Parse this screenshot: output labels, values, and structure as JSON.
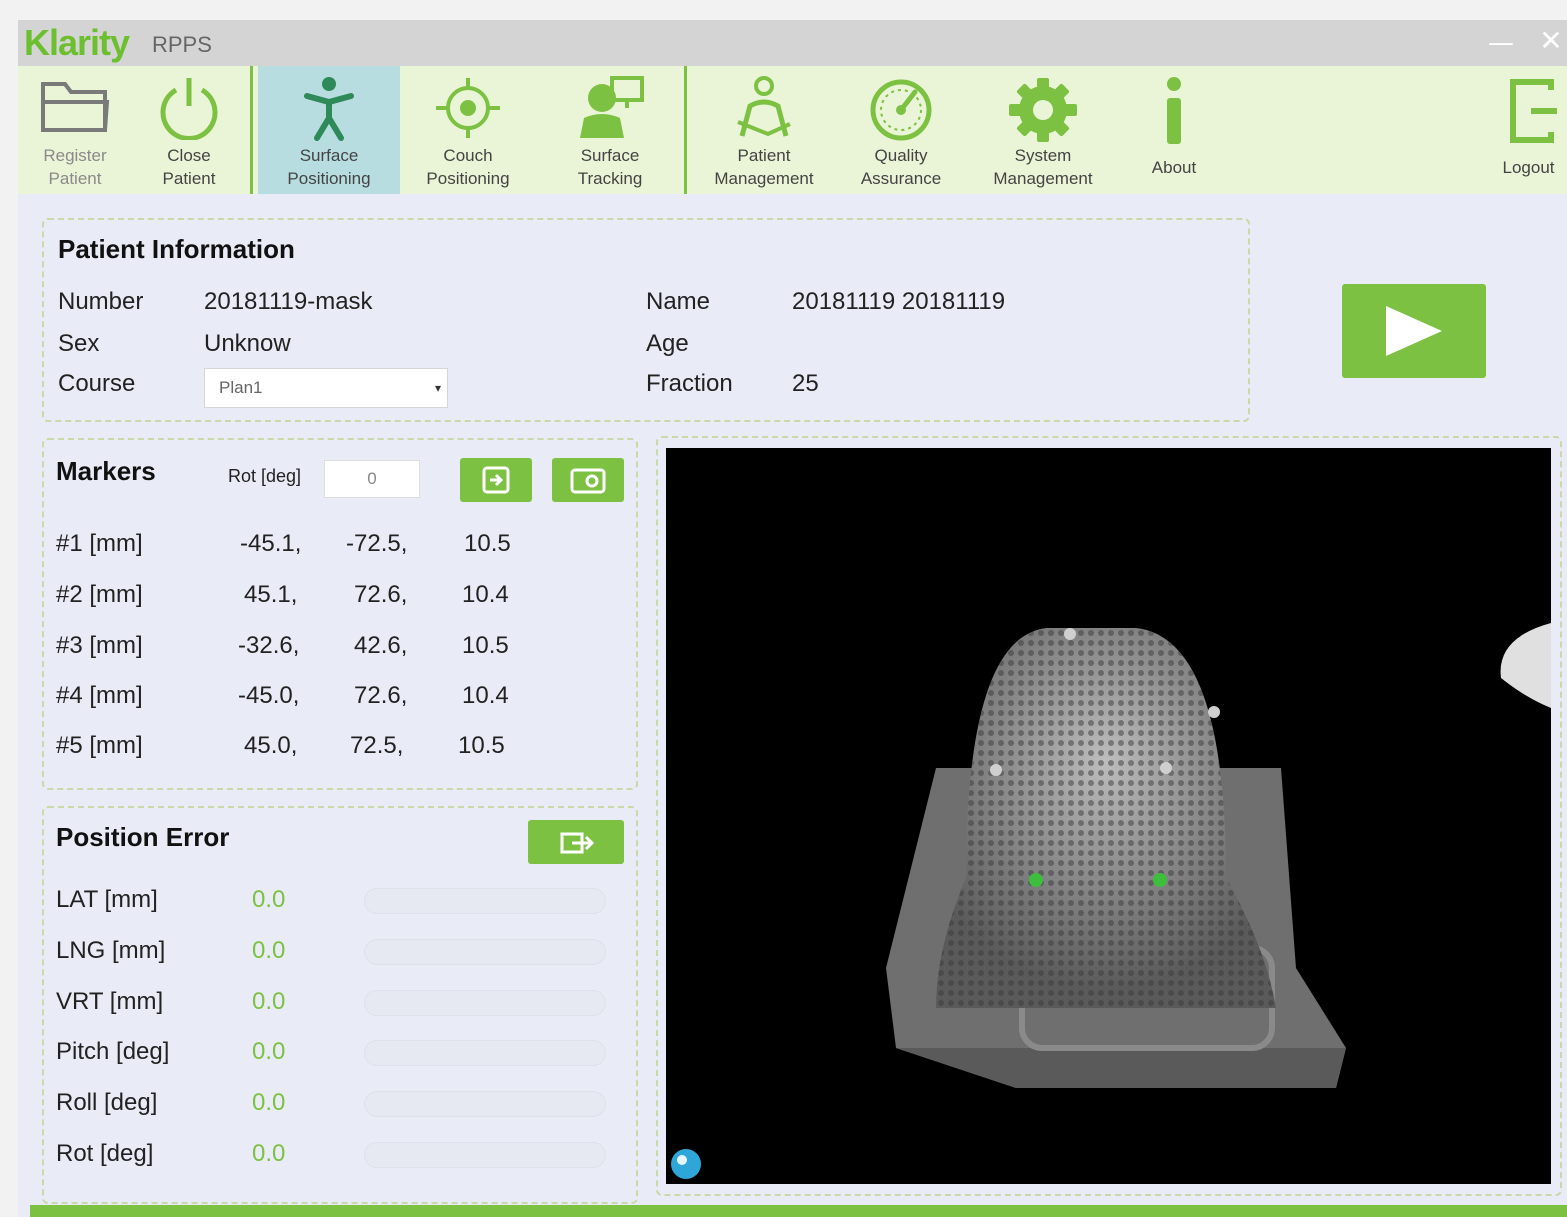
{
  "window": {
    "brand": "Klarity",
    "product": "RPPS",
    "minimize_glyph": "—",
    "close_glyph": "✕"
  },
  "toolbar": {
    "items": [
      {
        "line1": "Register",
        "line2": "Patient",
        "icon": "folder-icon",
        "state": "disabled"
      },
      {
        "line1": "Close",
        "line2": "Patient",
        "icon": "power-icon",
        "state": "normal"
      },
      {
        "line1": "Surface",
        "line2": "Positioning",
        "icon": "person-icon",
        "state": "active"
      },
      {
        "line1": "Couch",
        "line2": "Positioning",
        "icon": "crosshair-icon",
        "state": "normal"
      },
      {
        "line1": "Surface",
        "line2": "Tracking",
        "icon": "tracking-icon",
        "state": "normal"
      },
      {
        "line1": "Patient",
        "line2": "Management",
        "icon": "patient-management-icon",
        "state": "normal"
      },
      {
        "line1": "Quality",
        "line2": "Assurance",
        "icon": "gauge-icon",
        "state": "normal"
      },
      {
        "line1": "System",
        "line2": "Management",
        "icon": "gear-icon",
        "state": "normal"
      },
      {
        "line1": "About",
        "line2": "",
        "icon": "info-icon",
        "state": "normal"
      },
      {
        "line1": "Logout",
        "line2": "",
        "icon": "logout-icon",
        "state": "normal"
      }
    ]
  },
  "patient": {
    "title": "Patient Information",
    "number_label": "Number",
    "number_value": "20181119-mask",
    "sex_label": "Sex",
    "sex_value": "Unknow",
    "course_label": "Course",
    "course_value": "Plan1",
    "name_label": "Name",
    "name_value": "20181119 20181119",
    "age_label": "Age",
    "age_value": "",
    "fraction_label": "Fraction",
    "fraction_value": "25"
  },
  "markers": {
    "title": "Markers",
    "rot_label": "Rot [deg]",
    "rot_value": "0",
    "rows": [
      {
        "label": "#1 [mm]",
        "x": "-45.1,",
        "y": "-72.5,",
        "z": "10.5"
      },
      {
        "label": "#2 [mm]",
        "x": "45.1,",
        "y": "72.6,",
        "z": "10.4"
      },
      {
        "label": "#3 [mm]",
        "x": "-32.6,",
        "y": "42.6,",
        "z": "10.5"
      },
      {
        "label": "#4 [mm]",
        "x": "-45.0,",
        "y": "72.6,",
        "z": "10.4"
      },
      {
        "label": "#5 [mm]",
        "x": "45.0,",
        "y": "72.5,",
        "z": "10.5"
      }
    ]
  },
  "position_error": {
    "title": "Position Error",
    "rows": [
      {
        "label": "LAT [mm]",
        "value": "0.0",
        "fill": 0
      },
      {
        "label": "LNG [mm]",
        "value": "0.0",
        "fill": 0
      },
      {
        "label": "VRT [mm]",
        "value": "0.0",
        "fill": 0
      },
      {
        "label": "Pitch [deg]",
        "value": "0.0",
        "fill": 0
      },
      {
        "label": "Roll [deg]",
        "value": "0.0",
        "fill": 0
      },
      {
        "label": "Rot [deg]",
        "value": "0.0",
        "fill": 0
      }
    ]
  },
  "colors": {
    "accent_green": "#7cc142",
    "active_tab": "#b8dde0",
    "viewer_bg": "#000000"
  }
}
